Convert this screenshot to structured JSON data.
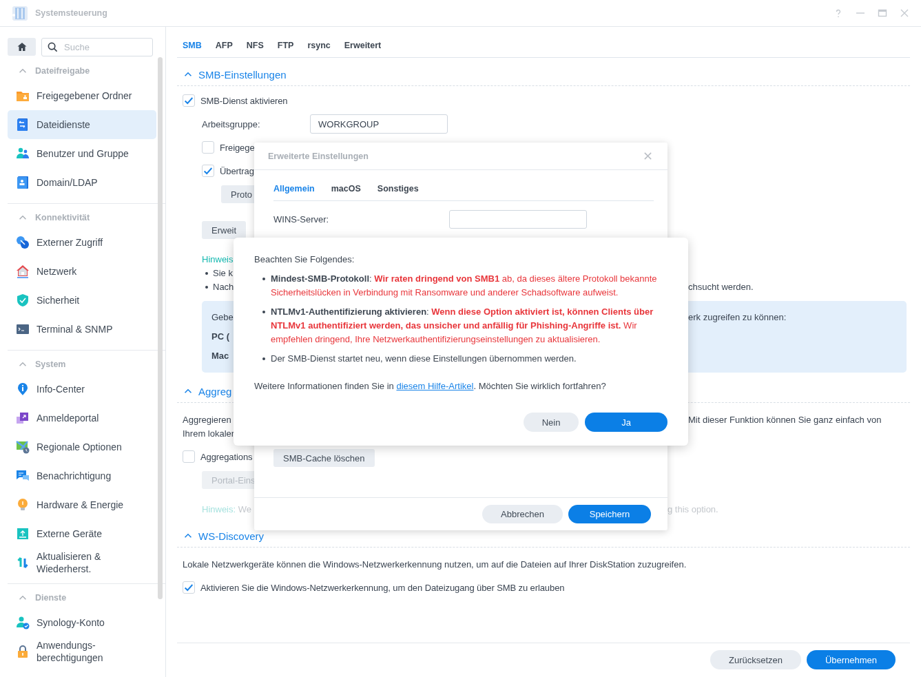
{
  "window": {
    "title": "Systemsteuerung"
  },
  "sidebar": {
    "search": {
      "placeholder": "Suche"
    },
    "groups": [
      {
        "title": "Dateifreigabe",
        "expanded": true,
        "items": [
          {
            "label": "Freigegebener Ordner",
            "selected": false
          },
          {
            "label": "Dateidienste",
            "selected": true
          },
          {
            "label": "Benutzer und Gruppe",
            "selected": false
          },
          {
            "label": "Domain/LDAP",
            "selected": false
          }
        ]
      },
      {
        "title": "Konnektivität",
        "expanded": true,
        "items": [
          {
            "label": "Externer Zugriff",
            "selected": false
          },
          {
            "label": "Netzwerk",
            "selected": false
          },
          {
            "label": "Sicherheit",
            "selected": false
          },
          {
            "label": "Terminal & SNMP",
            "selected": false
          }
        ]
      },
      {
        "title": "System",
        "expanded": true,
        "items": [
          {
            "label": "Info-Center",
            "selected": false
          },
          {
            "label": "Anmeldeportal",
            "selected": false
          },
          {
            "label": "Regionale Optionen",
            "selected": false
          },
          {
            "label": "Benachrichtigung",
            "selected": false
          },
          {
            "label": "Hardware & Energie",
            "selected": false
          },
          {
            "label": "Externe Geräte",
            "selected": false
          },
          {
            "label": "Aktualisieren & Wiederherst.",
            "selected": false
          }
        ]
      },
      {
        "title": "Dienste",
        "expanded": true,
        "items": [
          {
            "label": "Synology-Konto",
            "selected": false
          },
          {
            "label": "Anwendungs-berechtigungen",
            "selected": false
          }
        ]
      }
    ]
  },
  "tabs": [
    {
      "label": "SMB",
      "selected": true
    },
    {
      "label": "AFP",
      "selected": false
    },
    {
      "label": "NFS",
      "selected": false
    },
    {
      "label": "FTP",
      "selected": false
    },
    {
      "label": "rsync",
      "selected": false
    },
    {
      "label": "Erweitert",
      "selected": false
    }
  ],
  "sections": [
    {
      "title": "SMB-Einstellungen",
      "expanded": true,
      "rows": [
        {
          "kind": "checkbox",
          "label": "SMB-Dienst aktivieren",
          "checked": true,
          "children": [
            {
              "kind": "field",
              "label": "Arbeitsgruppe:",
              "value": "WORKGROUP"
            },
            {
              "kind": "checkbox",
              "label": "Freigege",
              "checked": false
            },
            {
              "kind": "checkbox",
              "label": "Übertrag",
              "checked": true,
              "children": [
                {
                  "kind": "button",
                  "label": "Proto",
                  "disabled": false
                }
              ]
            },
            {
              "kind": "button",
              "label": "Erweit",
              "disabled": false
            },
            {
              "kind": "hint",
              "label": "Hinweis",
              "disabled": false
            },
            {
              "kind": "bullet",
              "text": "Sie k"
            },
            {
              "kind": "bullet",
              "text": "Nach",
              "right": "chsucht werden."
            },
            {
              "kind": "infobox",
              "lines": [
                {
                  "text": "Gebe",
                  "right": "erk zugreifen zu können:",
                  "strong": false
                },
                {
                  "text": "PC (",
                  "strong": true
                },
                {
                  "text": "Mac",
                  "strong": true
                }
              ]
            }
          ]
        }
      ]
    },
    {
      "title": "Aggreg",
      "expanded": true,
      "rows": [
        {
          "kind": "text",
          "text": "Aggregieren",
          "right": "Mit dieser Funktion können Sie ganz einfach von"
        },
        {
          "kind": "text",
          "text": "Ihrem lokaler"
        },
        {
          "kind": "checkbox",
          "label": "Aggregations",
          "checked": false,
          "children": [
            {
              "kind": "button",
              "label": "Portal-Eins",
              "disabled": true
            },
            {
              "kind": "hint",
              "label": "Hinweis:",
              "text": "We",
              "right": "g this option.",
              "disabled": true
            }
          ]
        }
      ]
    },
    {
      "title": "WS-Discovery",
      "expanded": true,
      "rows": [
        {
          "kind": "text",
          "text": "Lokale Netzwerkgeräte können die Windows-Netzwerkerkennung nutzen, um auf die Dateien auf Ihrer DiskStation zuzugreifen."
        },
        {
          "kind": "checkbox",
          "label": "Aktivieren Sie die Windows-Netzwerkerkennung, um den Dateizugang über SMB zu erlauben",
          "checked": true
        }
      ]
    }
  ],
  "footer_buttons": [
    {
      "label": "Zurücksetzen",
      "kind": "secondary"
    },
    {
      "label": "Übernehmen",
      "kind": "primary"
    }
  ],
  "dialog": {
    "title": "Erweiterte Einstellungen",
    "tabs": [
      {
        "label": "Allgemein",
        "selected": true
      },
      {
        "label": "macOS",
        "selected": false
      },
      {
        "label": "Sonstiges",
        "selected": false
      }
    ],
    "fields": [
      {
        "label": "WINS-Server:"
      }
    ],
    "action": "SMB-Cache löschen",
    "buttons": [
      {
        "label": "Abbrechen",
        "kind": "secondary"
      },
      {
        "label": "Speichern",
        "kind": "primary"
      }
    ]
  },
  "alert": {
    "intro": "Beachten Sie Folgendes:",
    "bullets": [
      {
        "lead": "**Mindest-SMB-Protokoll**:",
        "text": "**Wir raten dringend von SMB1** ab, da dieses ältere Protokoll bekannte Sicherheitslücken in Verbindung mit Ransomware und anderer Schadsoftware aufweist.",
        "warning": true
      },
      {
        "lead": "**NTLMv1-Authentifizierung aktivieren**:",
        "text": "**Wenn diese Option aktiviert ist, können Clients über NTLMv1 authentifiziert werden, das unsicher und anfällig für Phishing-Angriffe ist.** Wir empfehlen dringend, Ihre Netzwerkauthentifizierungseinstellungen zu aktualisieren.",
        "warning": true
      },
      {
        "text": "Der SMB-Dienst startet neu, wenn diese Einstellungen übernommen werden.",
        "warning": false
      }
    ],
    "closing": {
      "before": "Weitere Informationen finden Sie in",
      "link": "diesem Hilfe-Artikel",
      "after": ". Möchten Sie wirklich fortfahren?"
    },
    "buttons": [
      {
        "label": "Nein",
        "kind": "secondary"
      },
      {
        "label": "Ja",
        "kind": "primary"
      }
    ]
  }
}
